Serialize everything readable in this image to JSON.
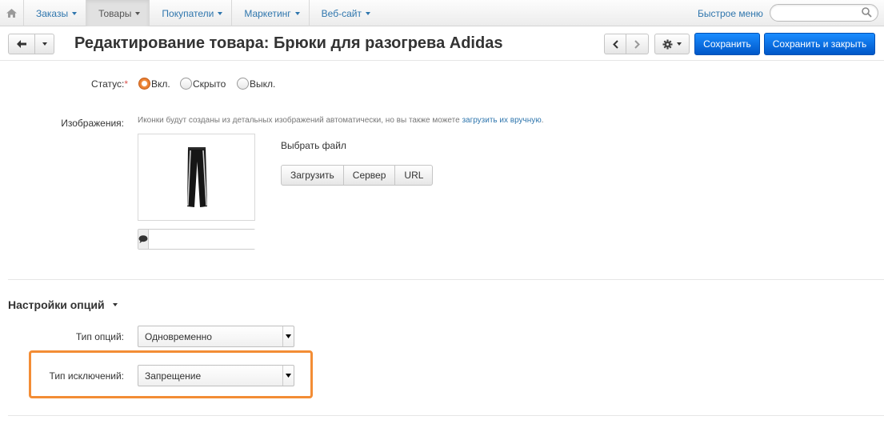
{
  "topnav": {
    "menu": [
      {
        "label": "Заказы"
      },
      {
        "label": "Товары"
      },
      {
        "label": "Покупатели"
      },
      {
        "label": "Маркетинг"
      },
      {
        "label": "Веб-сайт"
      }
    ],
    "quick_menu": "Быстрое меню",
    "search_value": ""
  },
  "header": {
    "title": "Редактирование товара: Брюки для разогрева Adidas",
    "save": "Сохранить",
    "save_close": "Сохранить и закрыть"
  },
  "form": {
    "status_label": "Статус:",
    "status_required": "*",
    "status_options": [
      {
        "label": "Вкл.",
        "checked": true
      },
      {
        "label": "Скрыто",
        "checked": false
      },
      {
        "label": "Выкл.",
        "checked": false
      }
    ],
    "images_label": "Изображения:",
    "images_hint": "Иконки будут созданы из детальных изображений автоматически, но вы также можете ",
    "images_hint_link": "загрузить их вручную",
    "images_hint_end": ".",
    "alt_value": "",
    "choose_file": "Выбрать файл",
    "upload_buttons": [
      "Загрузить",
      "Сервер",
      "URL"
    ]
  },
  "options_section": {
    "title": "Настройки опций",
    "option_type_label": "Тип опций:",
    "option_type_value": "Одновременно",
    "exception_type_label": "Тип исключений:",
    "exception_type_value": "Запрещение"
  },
  "colors": {
    "link": "#2f76ad",
    "primary": "#0a6fe0",
    "highlight": "#f38d35",
    "radio_on": "#e0732a"
  }
}
